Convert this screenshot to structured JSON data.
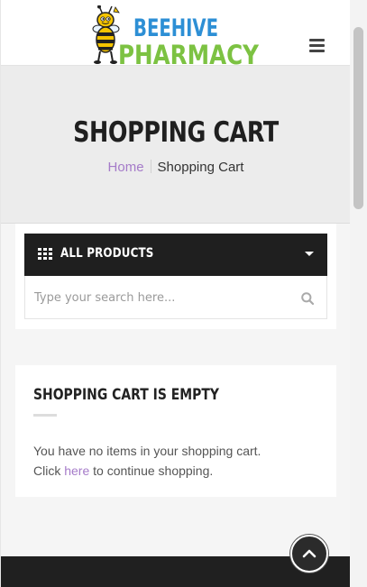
{
  "header": {
    "logo_line1": "BEEHIVE",
    "logo_line2": "PHARMACY",
    "menu_icon": "hamburger-icon"
  },
  "title_band": {
    "title": "SHOPPING CART",
    "breadcrumb": {
      "home": "Home",
      "current": "Shopping Cart"
    }
  },
  "products_widget": {
    "label": "ALL PRODUCTS",
    "grid_icon": "grid-icon",
    "caret_icon": "caret-down-icon",
    "search_placeholder": "Type your search here...",
    "search_icon": "search-icon"
  },
  "cart": {
    "title": "SHOPPING CART IS EMPTY",
    "line1": "You have no items in your shopping cart.",
    "line2_prefix": "Click",
    "link": "here",
    "line2_suffix": "to continue shopping."
  },
  "back_to_top": {
    "icon": "chevron-up-icon"
  },
  "colors": {
    "accent": "#a57bc9",
    "dark": "#1f1f1f",
    "logo_blue": "#2d8fd5",
    "logo_green": "#7cc242",
    "title_band": "#ececec"
  }
}
